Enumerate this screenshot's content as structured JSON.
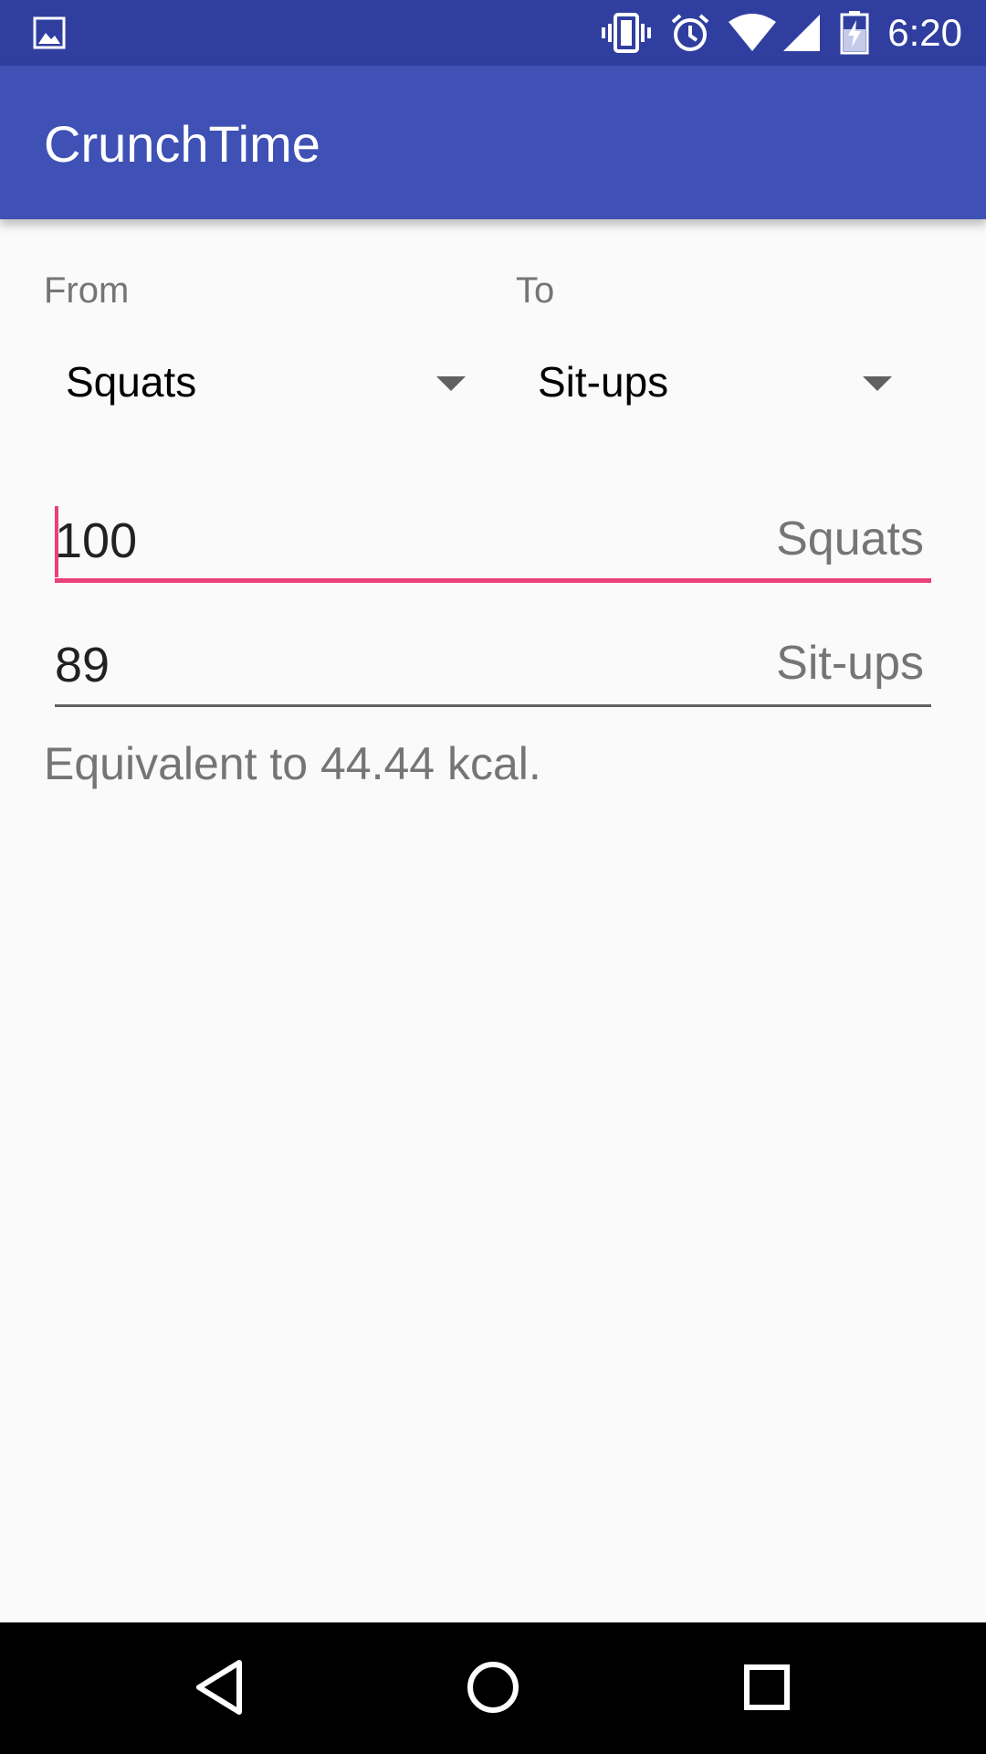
{
  "status_bar": {
    "time": "6:20",
    "icons": [
      "image-icon",
      "vibrate-icon",
      "alarm-icon",
      "wifi-icon",
      "signal-icon",
      "battery-charging-icon"
    ]
  },
  "app_bar": {
    "title": "CrunchTime"
  },
  "converter": {
    "from_label": "From",
    "to_label": "To",
    "from_exercise": "Squats",
    "to_exercise": "Sit-ups",
    "input_value": "100",
    "input_unit": "Squats",
    "output_value": "89",
    "output_unit": "Sit-ups",
    "result_text": "Equivalent to 44.44 kcal."
  },
  "colors": {
    "status_bar": "#303f9f",
    "primary": "#3f51b5",
    "accent": "#ec407a",
    "background": "#fafafa"
  },
  "nav_bar": {
    "buttons": [
      "back-icon",
      "home-icon",
      "recents-icon"
    ]
  }
}
